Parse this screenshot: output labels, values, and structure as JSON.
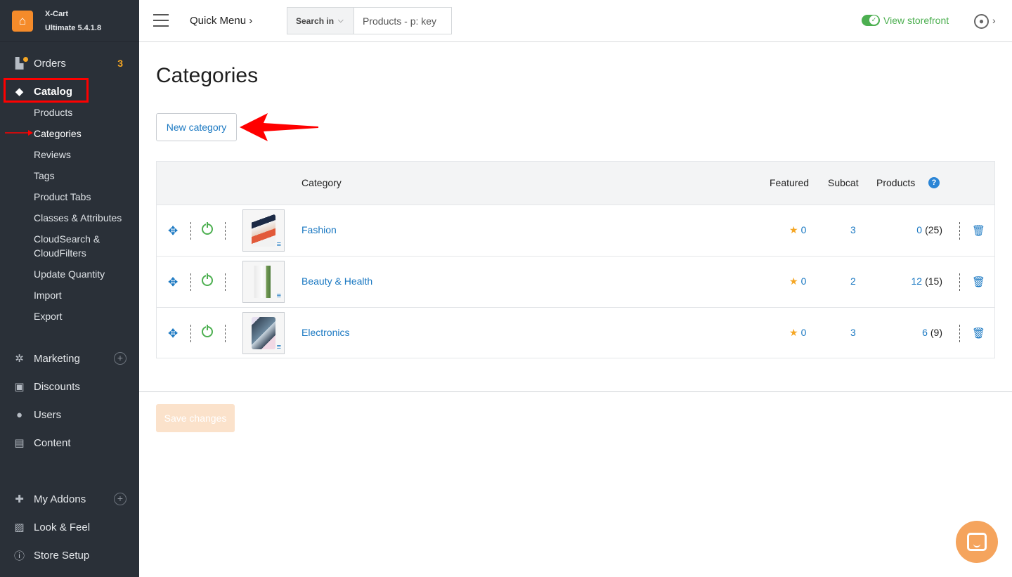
{
  "brand": {
    "name": "X-Cart",
    "edition": "Ultimate 5.4.1.8"
  },
  "sidebar": {
    "items": [
      {
        "label": "Orders",
        "badge": "3",
        "icon": "orders-icon"
      },
      {
        "label": "Catalog",
        "icon": "tag-icon"
      },
      {
        "label": "Marketing",
        "icon": "marketing-icon"
      },
      {
        "label": "Discounts",
        "icon": "gift-icon"
      },
      {
        "label": "Users",
        "icon": "users-icon"
      },
      {
        "label": "Content",
        "icon": "content-icon"
      },
      {
        "label": "My Addons",
        "icon": "puzzle-icon"
      },
      {
        "label": "Look & Feel",
        "icon": "image-icon"
      },
      {
        "label": "Store Setup",
        "icon": "info-icon"
      }
    ],
    "catalog_sub": [
      "Products",
      "Categories",
      "Reviews",
      "Tags",
      "Product Tabs",
      "Classes & Attributes",
      "CloudSearch &",
      "CloudFilters",
      "Update Quantity",
      "Import",
      "Export"
    ]
  },
  "topbar": {
    "quick_menu": "Quick Menu",
    "search_in": "Search in",
    "search_placeholder": "Products - p: key",
    "view_storefront": "View storefront"
  },
  "main": {
    "title": "Categories",
    "new_category": "New category",
    "columns": {
      "category": "Category",
      "featured": "Featured",
      "subcat": "Subcat",
      "products": "Products"
    },
    "rows": [
      {
        "name": "Fashion",
        "featured": "0",
        "subcat": "3",
        "products": "0",
        "total": "(25)"
      },
      {
        "name": "Beauty & Health",
        "featured": "0",
        "subcat": "2",
        "products": "12",
        "total": "(15)"
      },
      {
        "name": "Electronics",
        "featured": "0",
        "subcat": "3",
        "products": "6",
        "total": "(9)"
      }
    ],
    "save": "Save changes"
  },
  "colors": {
    "accent": "#1a78c2",
    "brand": "#f58b2a",
    "sidebar": "#2a3038",
    "annotation": "#ff0000",
    "success": "#4caf50"
  }
}
